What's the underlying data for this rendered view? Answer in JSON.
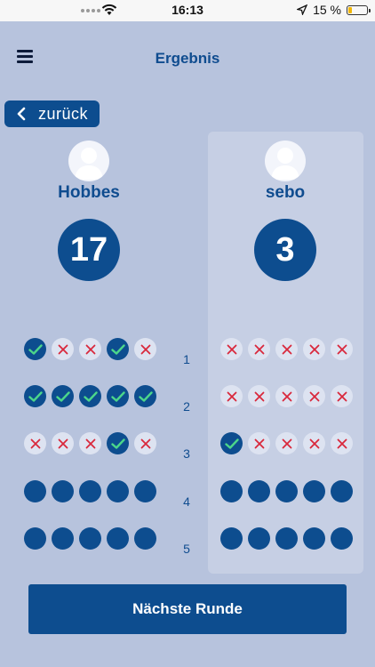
{
  "status_bar": {
    "time": "16:13",
    "battery_text": "15 %"
  },
  "header": {
    "title": "Ergebnis",
    "back_label": "zurück"
  },
  "players": [
    {
      "name": "Hobbes",
      "score": "17",
      "rounds": [
        [
          "check",
          "miss",
          "miss",
          "check",
          "miss"
        ],
        [
          "check",
          "check",
          "check",
          "check",
          "check"
        ],
        [
          "miss",
          "miss",
          "miss",
          "check",
          "miss"
        ],
        [
          "empty",
          "empty",
          "empty",
          "empty",
          "empty"
        ],
        [
          "empty",
          "empty",
          "empty",
          "empty",
          "empty"
        ]
      ]
    },
    {
      "name": "sebo",
      "score": "3",
      "rounds": [
        [
          "miss",
          "miss",
          "miss",
          "miss",
          "miss"
        ],
        [
          "miss",
          "miss",
          "miss",
          "miss",
          "miss"
        ],
        [
          "check",
          "miss",
          "miss",
          "miss",
          "miss"
        ],
        [
          "empty",
          "empty",
          "empty",
          "empty",
          "empty"
        ],
        [
          "empty",
          "empty",
          "empty",
          "empty",
          "empty"
        ]
      ]
    }
  ],
  "round_numbers": [
    "1",
    "2",
    "3",
    "4",
    "5"
  ],
  "footer": {
    "next_round_label": "Nächste Runde"
  },
  "colors": {
    "primary": "#0d4d8f",
    "background": "#b7c3dd",
    "check": "#4cd68a",
    "miss": "#d9283c"
  }
}
